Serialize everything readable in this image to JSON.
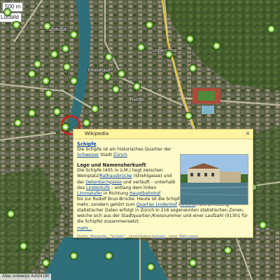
{
  "map": {
    "scale_control": "500 m",
    "layer_label": "Luftbild",
    "bottom_attribution": "Atlas ontwerps 4v024190",
    "street_labels": [
      "Bahnhofstr.",
      "Limmatquai",
      "Universitätstr.",
      "Rämistr."
    ]
  },
  "popup": {
    "header": "Wikipedia",
    "title": "Schipfe",
    "p1_parts": [
      "Die Schipfe ist ein historisches Quartier der ",
      "Schweizer",
      " Stadt ",
      "Zürich",
      "."
    ],
    "section_heading": "Lage und Namensherkunft",
    "p2_a": "Die Schipfe (405 m ü.M.) liegt zwischen Weinplatz/",
    "p2_link1": "Rathausbrücke",
    "p2_b": " (Strehlgasse) und der ",
    "p2_link2": "Detenbachgasse",
    "p2_c": " und verläuft – unterhalb des ",
    "p2_link3": "Lindenhofs",
    "p2_d": " – entlang dem linken ",
    "p2_link4": "Limmatufer",
    "p2_e": " in Richtung ",
    "p2_link5": "Hauptbahnhof",
    "p2_f": " bis zur Rudolf Brun-Brücke. Heute ist die Schipfe kein eigenständiger Stadtteil mehr, sondern gehört zum ",
    "p2_link6": "Quartier Lindenhof",
    "p2_g": " (",
    "p2_link7": "Kreis 1",
    "p2_h": "). Die Erhebung statistischer Daten erfolgt in Zürich in 216 sogenannten statistischen Zonen, welche sich aus der Stadtquartier-/Kreisnummer und einer Laufzahl (01301 für die Schipfe) zusammensetzt.",
    "more_link": "mehr...",
    "footer_a": "Quelle: ",
    "footer_link1": "Wikipedia",
    "footer_b": " - ",
    "footer_link2": "\"Schipfe\"",
    "footer_c": " - verschiedene ",
    "footer_link3": "Autoren",
    "footer_d": " - unter ",
    "footer_link4": "GNU-Lizenz"
  },
  "colors": {
    "popup_bg": "#fffbc8",
    "link": "#0645ad",
    "pin": "#8fd14f",
    "marker_ring": "#e01818",
    "river": "#2f6f7a"
  }
}
